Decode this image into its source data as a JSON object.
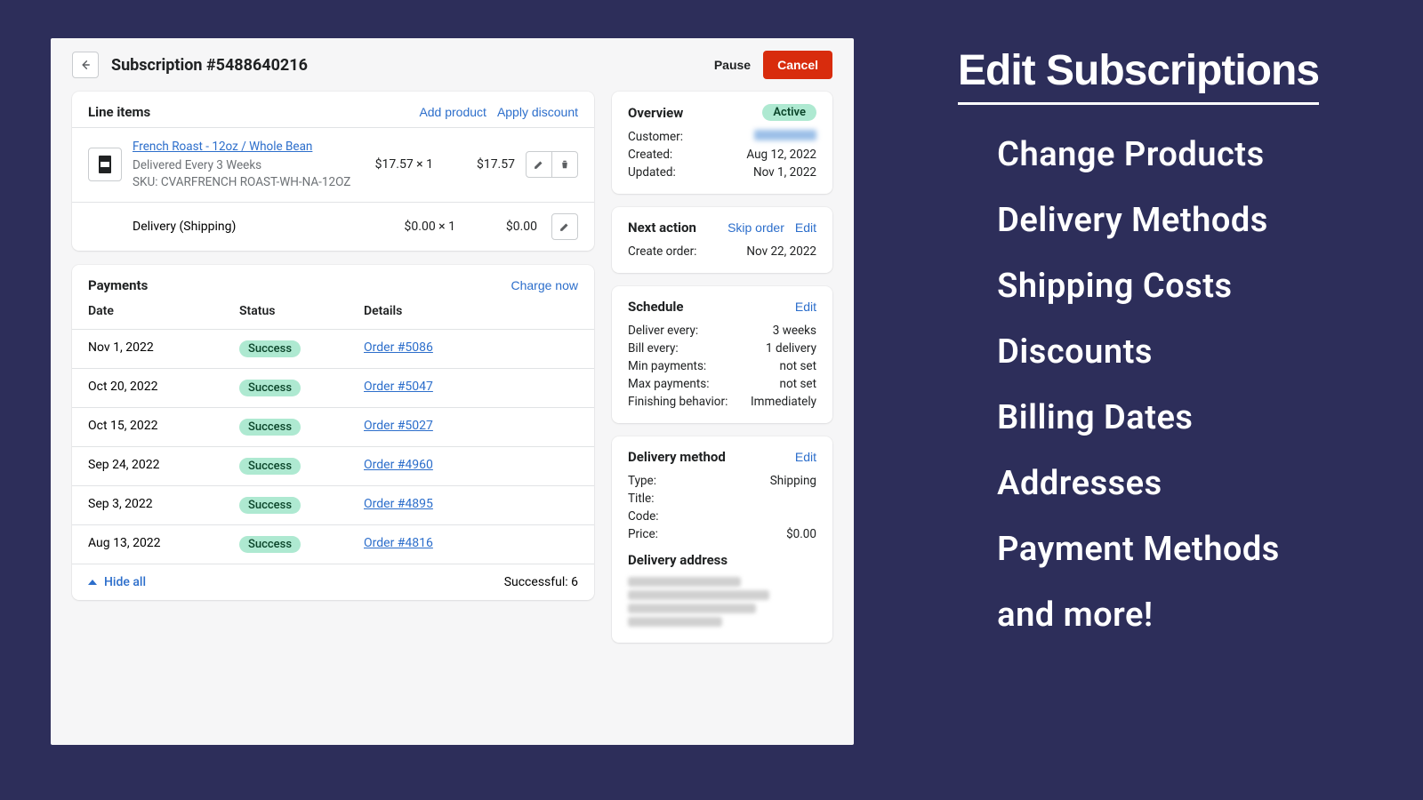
{
  "header": {
    "title": "Subscription #5488640216",
    "pause": "Pause",
    "cancel": "Cancel"
  },
  "lineItems": {
    "title": "Line items",
    "addProduct": "Add product",
    "applyDiscount": "Apply discount",
    "product": {
      "name": "French Roast - 12oz / Whole Bean",
      "delivery": "Delivered Every 3 Weeks",
      "sku": "SKU: CVARFRENCH ROAST-WH-NA-12OZ",
      "unit": "$17.57 × 1",
      "total": "$17.57"
    },
    "shipping": {
      "label": "Delivery (Shipping)",
      "unit": "$0.00 × 1",
      "total": "$0.00"
    }
  },
  "payments": {
    "title": "Payments",
    "chargeNow": "Charge now",
    "headers": {
      "date": "Date",
      "status": "Status",
      "details": "Details"
    },
    "rows": [
      {
        "date": "Nov 1, 2022",
        "status": "Success",
        "order": "Order #5086"
      },
      {
        "date": "Oct 20, 2022",
        "status": "Success",
        "order": "Order #5047"
      },
      {
        "date": "Oct 15, 2022",
        "status": "Success",
        "order": "Order #5027"
      },
      {
        "date": "Sep 24, 2022",
        "status": "Success",
        "order": "Order #4960"
      },
      {
        "date": "Sep 3, 2022",
        "status": "Success",
        "order": "Order #4895"
      },
      {
        "date": "Aug 13, 2022",
        "status": "Success",
        "order": "Order #4816"
      }
    ],
    "hideAll": "Hide all",
    "successful": "Successful: 6"
  },
  "overview": {
    "title": "Overview",
    "status": "Active",
    "customerLabel": "Customer:",
    "createdLabel": "Created:",
    "created": "Aug 12, 2022",
    "updatedLabel": "Updated:",
    "updated": "Nov 1, 2022"
  },
  "nextAction": {
    "title": "Next action",
    "skip": "Skip order",
    "edit": "Edit",
    "createLabel": "Create order:",
    "create": "Nov 22, 2022"
  },
  "schedule": {
    "title": "Schedule",
    "edit": "Edit",
    "deliverLabel": "Deliver every:",
    "deliver": "3 weeks",
    "billLabel": "Bill every:",
    "bill": "1 delivery",
    "minLabel": "Min payments:",
    "min": "not set",
    "maxLabel": "Max payments:",
    "max": "not set",
    "finishLabel": "Finishing behavior:",
    "finish": "Immediately"
  },
  "deliveryMethod": {
    "title": "Delivery method",
    "edit": "Edit",
    "typeLabel": "Type:",
    "type": "Shipping",
    "titleLabel": "Title:",
    "titleVal": "",
    "codeLabel": "Code:",
    "code": "",
    "priceLabel": "Price:",
    "price": "$0.00",
    "addressHeading": "Delivery address"
  },
  "marketing": {
    "heading": "Edit Subscriptions",
    "items": [
      "Change Products",
      "Delivery Methods",
      "Shipping Costs",
      "Discounts",
      "Billing Dates",
      "Addresses",
      "Payment Methods",
      "and more!"
    ]
  }
}
